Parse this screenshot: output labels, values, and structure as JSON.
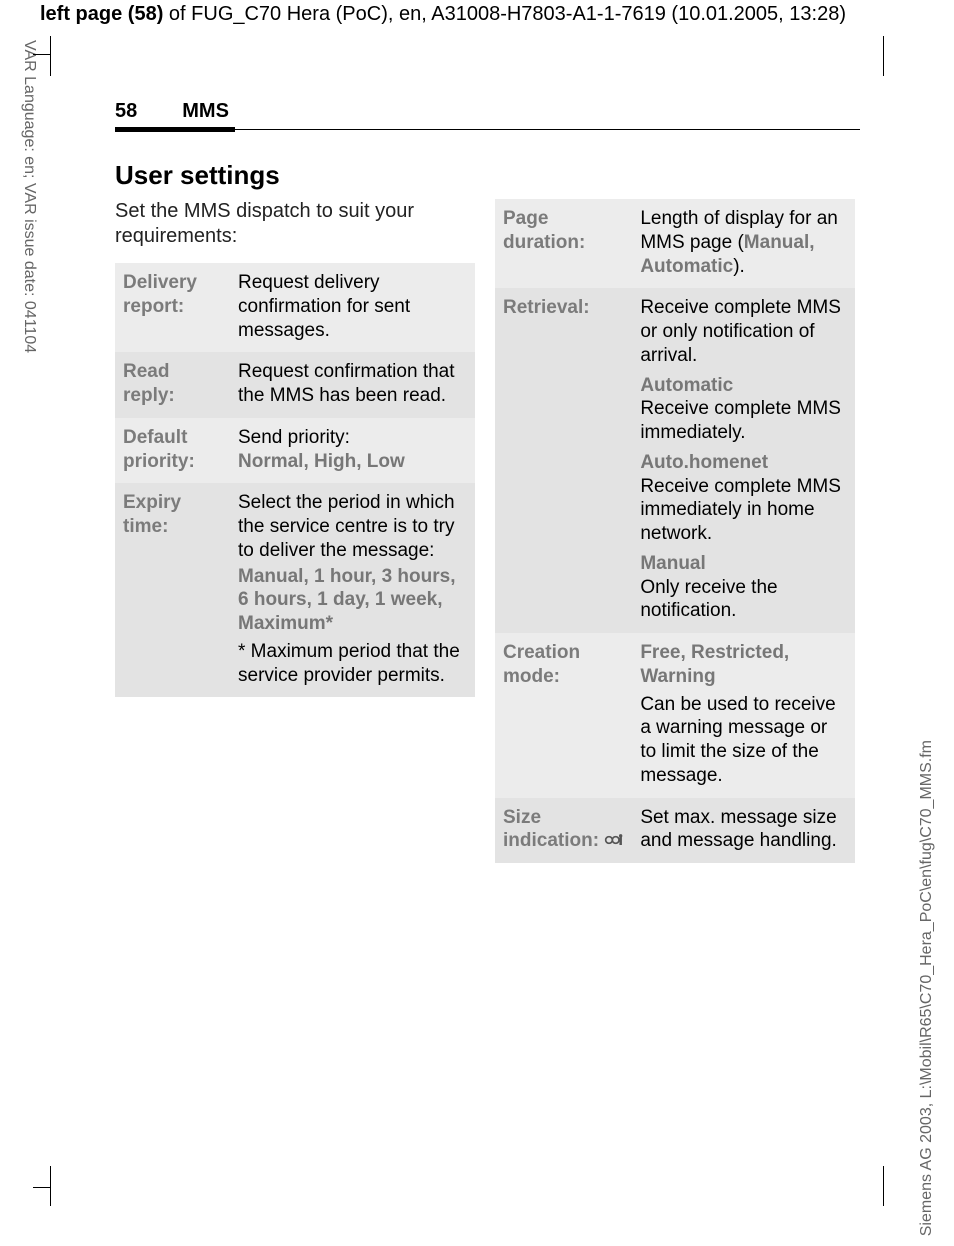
{
  "topBanner": {
    "bold": "left page (58)",
    "rest": " of FUG_C70 Hera (PoC), en, A31008-H7803-A1-1-7619 (10.01.2005, 13:28)"
  },
  "sideLeft": "VAR Language: en; VAR issue date: 041104",
  "sideRight": "Siemens AG 2003, L:\\Mobil\\R65\\C70_Hera_PoC\\en\\fug\\C70_MMS.fm",
  "header": {
    "pageNumber": "58",
    "section": "MMS"
  },
  "h2": "User settings",
  "intro": "Set the MMS dispatch to suit your requirements:",
  "leftTable": [
    {
      "label": "Delivery report:",
      "body": "Request delivery confirmation for sent messages."
    },
    {
      "label": "Read reply:",
      "body": "Request confirmation that the MMS has been read."
    },
    {
      "label": "Default priority:",
      "bodyPrefix": "Send priority:",
      "opts": "Normal, High, Low"
    },
    {
      "label": "Expiry time:",
      "bodyPrefix": "Select the period in which the service centre is to try to deliver the message:",
      "opts": "Manual, 1 hour, 3 hours, 6 hours, 1 day, 1 week, Maximum*",
      "suffix": "* Maximum period that the service provider permits."
    }
  ],
  "rightTable": [
    {
      "label": "Page duration:",
      "pre": "Length of display for an MMS page (",
      "opts": "Manual, Automatic",
      "post": ")."
    },
    {
      "label": "Retrieval:",
      "intro": "Receive complete MMS or only notification of arrival.",
      "s1h": "Automatic",
      "s1b": "Receive complete MMS immediately.",
      "s2h": "Auto.homenet",
      "s2b": "Receive complete MMS immediately in home network.",
      "s3h": "Manual",
      "s3b": "Only receive the notification."
    },
    {
      "label": "Creation mode:",
      "opts": "Free, Restricted, Warning",
      "body": "Can be used to receive a warning message or to limit the size of the message."
    },
    {
      "label": "Size indication: ",
      "operatorIcon": true,
      "body": "Set max. message size and message handling."
    }
  ]
}
